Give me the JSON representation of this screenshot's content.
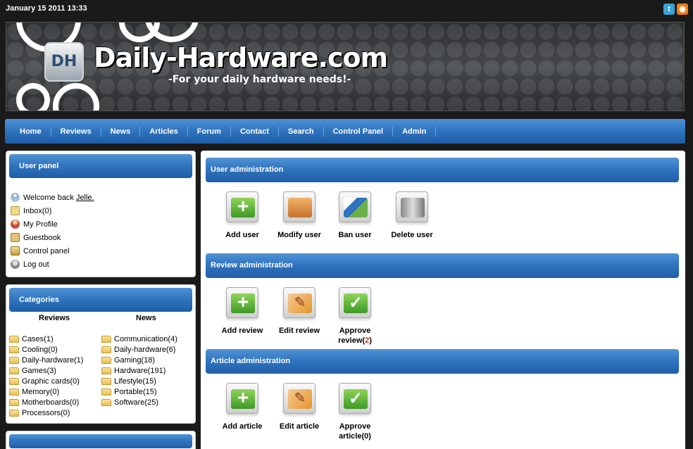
{
  "topbar": {
    "datetime": "January 15 2011 13:33"
  },
  "social": {
    "twitter_icon": "twitter-icon",
    "rss_icon": "rss-icon"
  },
  "banner": {
    "logo_text": "DH",
    "title": "Daily-Hardware.com",
    "tagline": "-For your daily hardware needs!-"
  },
  "nav": {
    "items": [
      "Home",
      "Reviews",
      "News",
      "Articles",
      "Forum",
      "Contact",
      "Search",
      "Control Panel",
      "Admin"
    ]
  },
  "user_panel": {
    "title": "User panel",
    "welcome": "Welcome back",
    "username": "Jelle.",
    "inbox": "Inbox(0)",
    "profile": "My Profile",
    "guestbook": "Guestbook",
    "control_panel": "Control panel",
    "logout": "Log out"
  },
  "categories": {
    "title": "Categories",
    "reviews_heading": "Reviews",
    "news_heading": "News",
    "reviews": [
      "Cases(1)",
      "Cooling(0)",
      "Daily-hardware(1)",
      "Games(3)",
      "Graphic cards(0)",
      "Memory(0)",
      "Motherboards(0)",
      "Processors(0)"
    ],
    "news": [
      "Communication(4)",
      "Daily-hardware(6)",
      "Gaming(18)",
      "Hardware(191)",
      "Lifestyle(15)",
      "Portable(15)",
      "Software(25)"
    ]
  },
  "admin": {
    "user": {
      "title": "User administration",
      "add": "Add user",
      "modify": "Modify user",
      "ban": "Ban user",
      "delete": "Delete user"
    },
    "review": {
      "title": "Review administration",
      "add": "Add review",
      "edit": "Edit review",
      "approve_label": "Approve review(",
      "approve_count": "2",
      "approve_close": ")"
    },
    "article": {
      "title": "Article administration",
      "add": "Add article",
      "edit": "Edit article",
      "approve_label": "Approve article(0)"
    }
  }
}
